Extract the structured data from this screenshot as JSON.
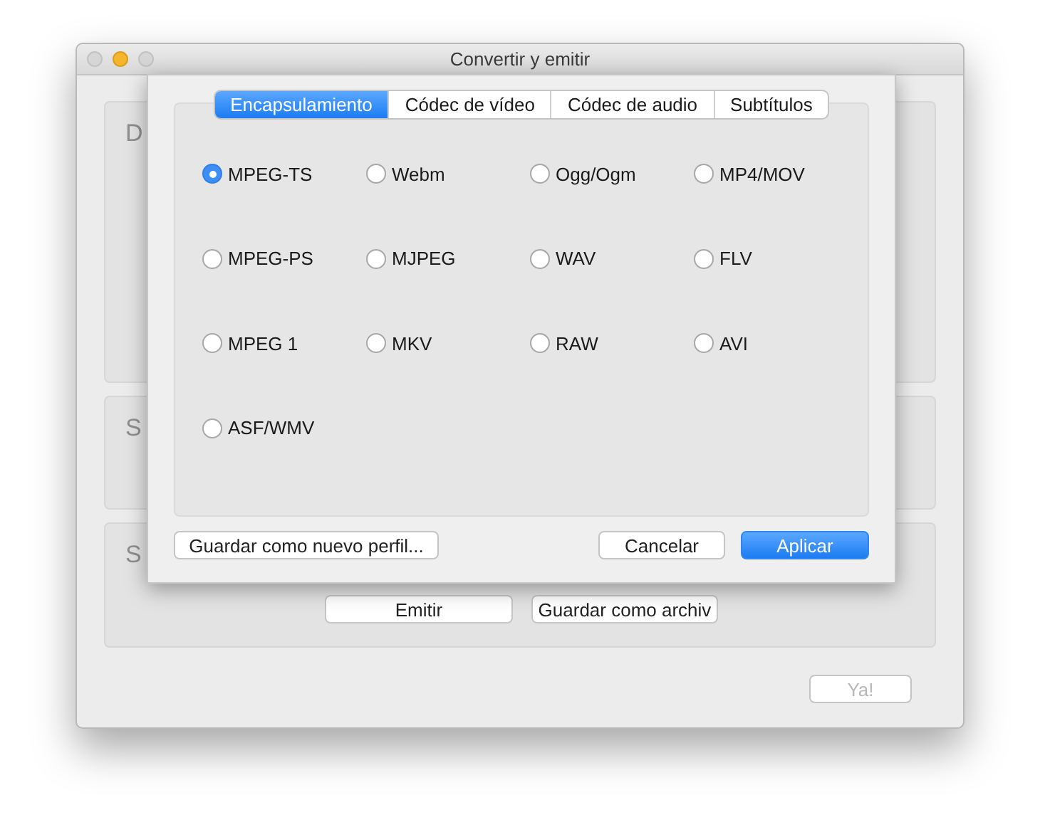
{
  "window": {
    "title": "Convertir y emitir"
  },
  "background": {
    "sections": [
      {
        "label": "D"
      },
      {
        "label": "S"
      },
      {
        "label": "S"
      }
    ],
    "stream_buttons": [
      "Emitir",
      "Guardar como archiv"
    ],
    "confirm_button": {
      "label": "Ya!",
      "disabled": true
    }
  },
  "sheet": {
    "tabs": [
      {
        "label": "Encapsulamiento",
        "selected": true
      },
      {
        "label": "Códec de vídeo",
        "selected": false
      },
      {
        "label": "Códec de audio",
        "selected": false
      },
      {
        "label": "Subtítulos",
        "selected": false
      }
    ],
    "formats": [
      {
        "label": "MPEG-TS",
        "selected": true
      },
      {
        "label": "Webm",
        "selected": false
      },
      {
        "label": "Ogg/Ogm",
        "selected": false
      },
      {
        "label": "MP4/MOV",
        "selected": false
      },
      {
        "label": "MPEG-PS",
        "selected": false
      },
      {
        "label": "MJPEG",
        "selected": false
      },
      {
        "label": "WAV",
        "selected": false
      },
      {
        "label": "FLV",
        "selected": false
      },
      {
        "label": "MPEG 1",
        "selected": false
      },
      {
        "label": "MKV",
        "selected": false
      },
      {
        "label": "RAW",
        "selected": false
      },
      {
        "label": "AVI",
        "selected": false
      },
      {
        "label": "ASF/WMV",
        "selected": false
      }
    ],
    "buttons": [
      {
        "label": "Guardar como nuevo perfil...",
        "kind": "default"
      },
      {
        "label": "Cancelar",
        "kind": "default"
      },
      {
        "label": "Aplicar",
        "kind": "primary"
      }
    ]
  }
}
